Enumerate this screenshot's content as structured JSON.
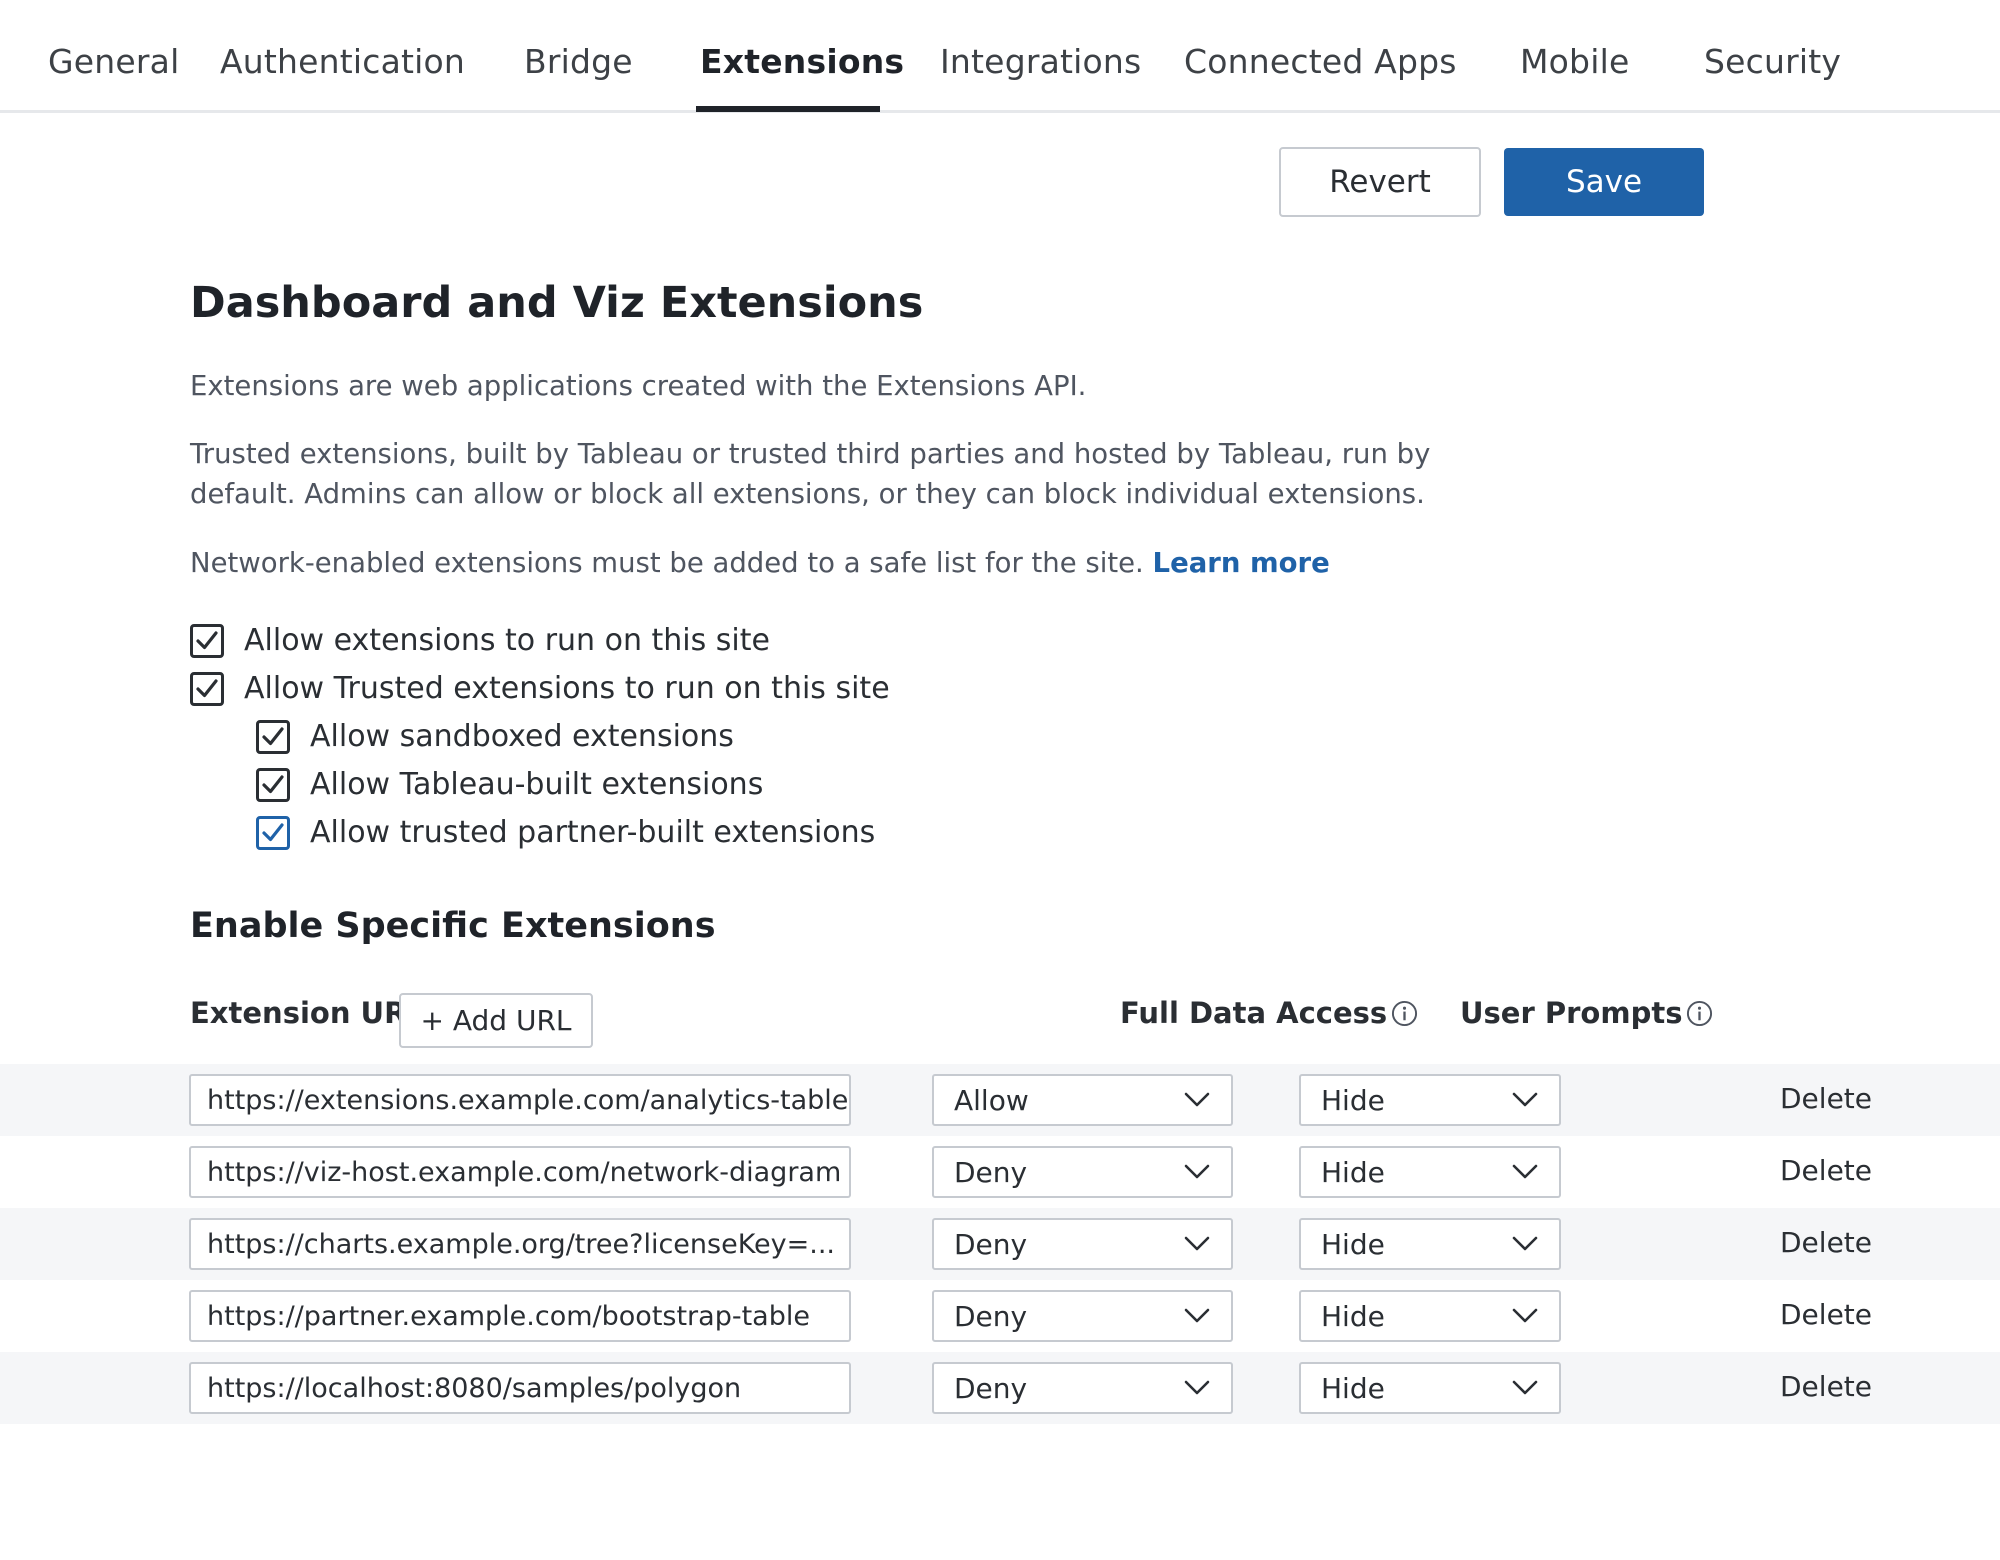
{
  "tabs": [
    {
      "label": "General",
      "active": false
    },
    {
      "label": "Authentication",
      "active": false
    },
    {
      "label": "Bridge",
      "active": false
    },
    {
      "label": "Extensions",
      "active": true
    },
    {
      "label": "Integrations",
      "active": false
    },
    {
      "label": "Connected Apps",
      "active": false
    },
    {
      "label": "Mobile",
      "active": false
    },
    {
      "label": "Security",
      "active": false
    }
  ],
  "toolbar": {
    "revert_label": "Revert",
    "save_label": "Save"
  },
  "section": {
    "title": "Dashboard and Viz Extensions",
    "para1": "Extensions are web applications created with the Extensions API.",
    "para2_line1": "Trusted extensions, built by Tableau or trusted third parties and hosted by Tableau, run by",
    "para2_line2": "default. Admins can allow or block all extensions, or they can block individual extensions.",
    "para3": "Network-enabled extensions must be added to a safe list for the site.",
    "learn_more": "Learn more"
  },
  "checkboxes": [
    {
      "label": "Allow extensions to run on this site",
      "checked": true
    },
    {
      "label": "Allow Trusted extensions to run on this site",
      "checked": true
    },
    {
      "label": "Allow sandboxed extensions",
      "checked": true
    },
    {
      "label": "Allow Tableau-built extensions",
      "checked": true
    },
    {
      "label": "Allow trusted partner-built extensions",
      "checked": true
    }
  ],
  "specific": {
    "title": "Enable Specific Extensions",
    "col_url": "Extension URL",
    "add_url": "+ Add URL",
    "col_access": "Full Data Access",
    "col_prompts": "User Prompts",
    "rows": [
      {
        "url": "https://extensions.example.com/analytics-table",
        "access": "Allow",
        "prompts": "Hide",
        "action": "Delete"
      },
      {
        "url": "https://viz-host.example.com/network-diagram",
        "access": "Deny",
        "prompts": "Hide",
        "action": "Delete"
      },
      {
        "url": "https://charts.example.org/tree?licenseKey=...",
        "access": "Deny",
        "prompts": "Hide",
        "action": "Delete"
      },
      {
        "url": "https://partner.example.com/bootstrap-table",
        "access": "Deny",
        "prompts": "Hide",
        "action": "Delete"
      },
      {
        "url": "https://localhost:8080/samples/polygon",
        "access": "Deny",
        "prompts": "Hide",
        "action": "Delete"
      }
    ]
  },
  "colors": {
    "accent": "#1f62a8",
    "text": "#1f2329",
    "muted": "#4f5560",
    "border": "#c6cad0",
    "row_shade": "#f5f6f8"
  }
}
